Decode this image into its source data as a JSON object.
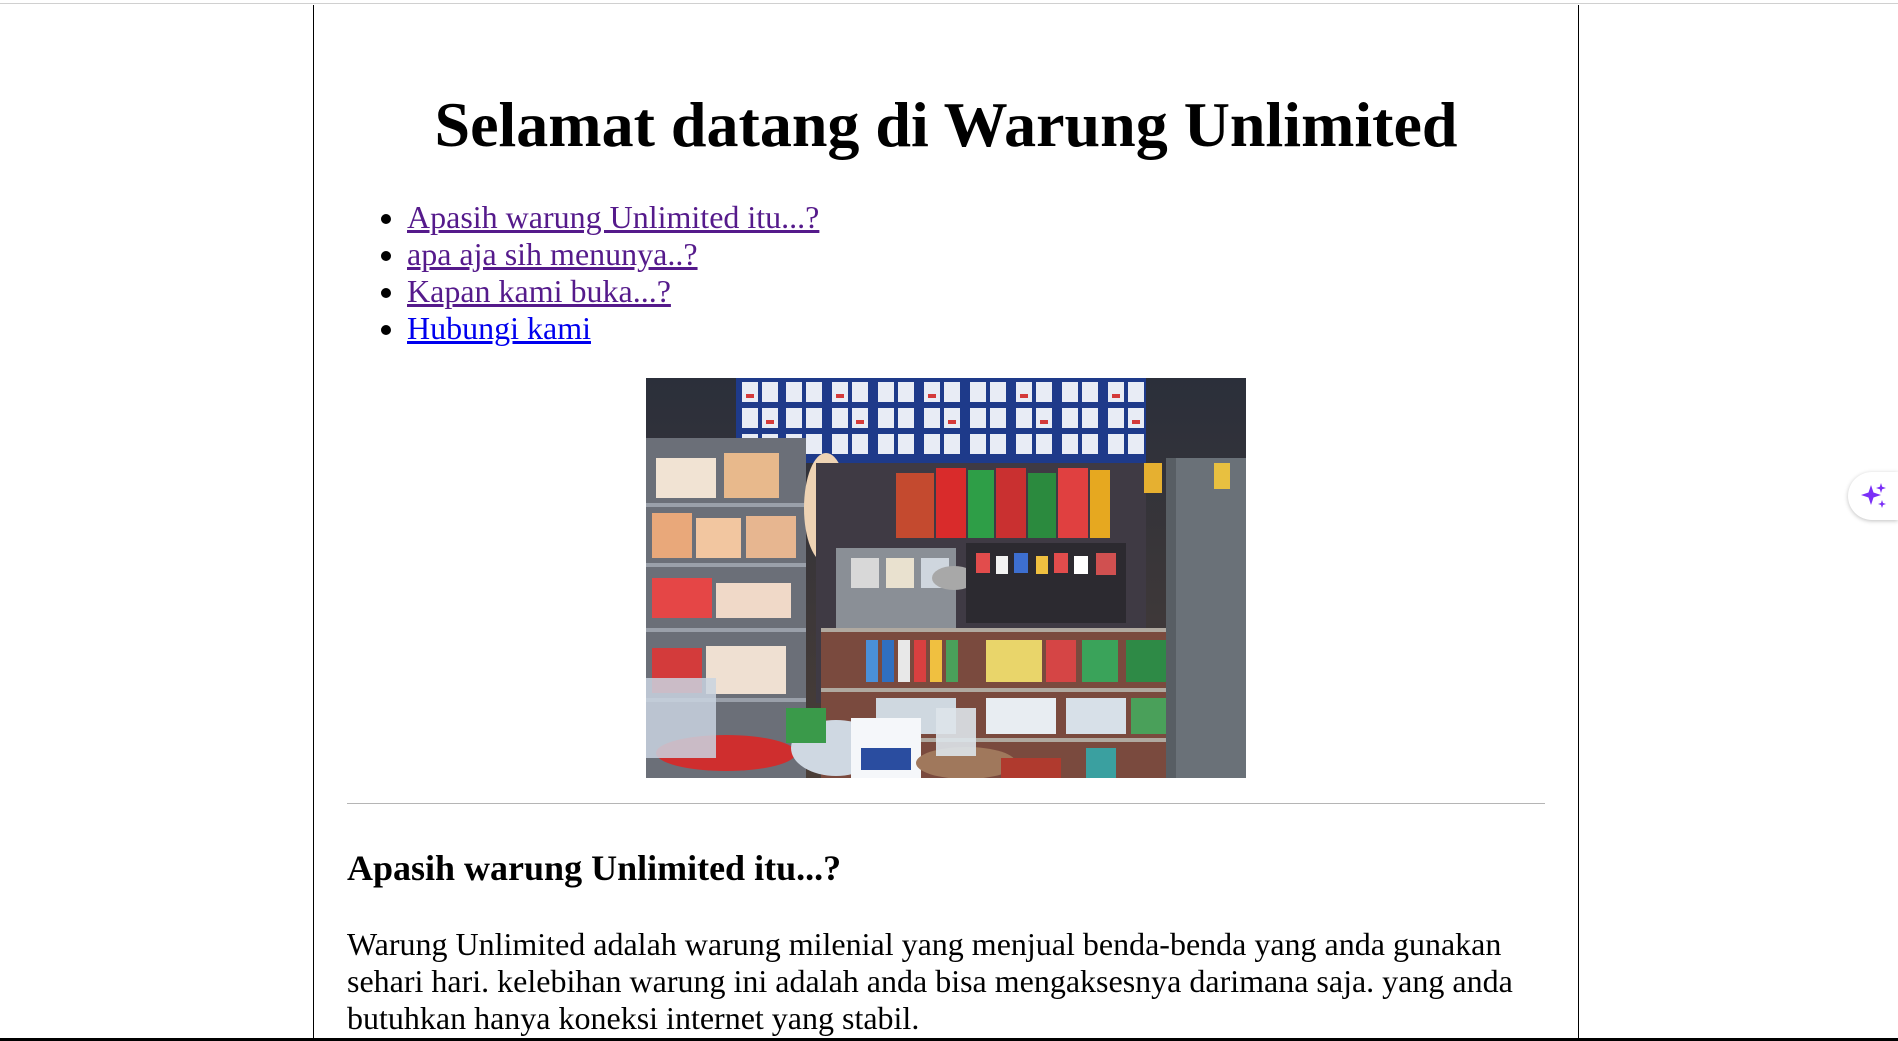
{
  "page": {
    "title": "Selamat datang di Warung Unlimited"
  },
  "nav": {
    "items": [
      {
        "label": "Apasih warung Unlimited itu...?",
        "state": "visited"
      },
      {
        "label": "apa aja sih menunya..?",
        "state": "visited"
      },
      {
        "label": "Kapan kami buka...?",
        "state": "visited"
      },
      {
        "label": "Hubungi kami",
        "state": "unvisited"
      }
    ]
  },
  "hero": {
    "alt": "warung shop shelves"
  },
  "section": {
    "heading": "Apasih warung Unlimited itu...?",
    "body": "Warung Unlimited adalah warung milenial yang menjual benda-benda yang anda gunakan sehari hari. kelebihan warung ini adalah anda bisa mengaksesnya darimana saja. yang anda butuhkan hanya koneksi internet yang stabil."
  },
  "widget": {
    "icon": "sparkle-icon",
    "color": "#7b2ff7"
  },
  "colors": {
    "link_visited": "#551a8b",
    "link_unvisited": "#0000ee"
  }
}
